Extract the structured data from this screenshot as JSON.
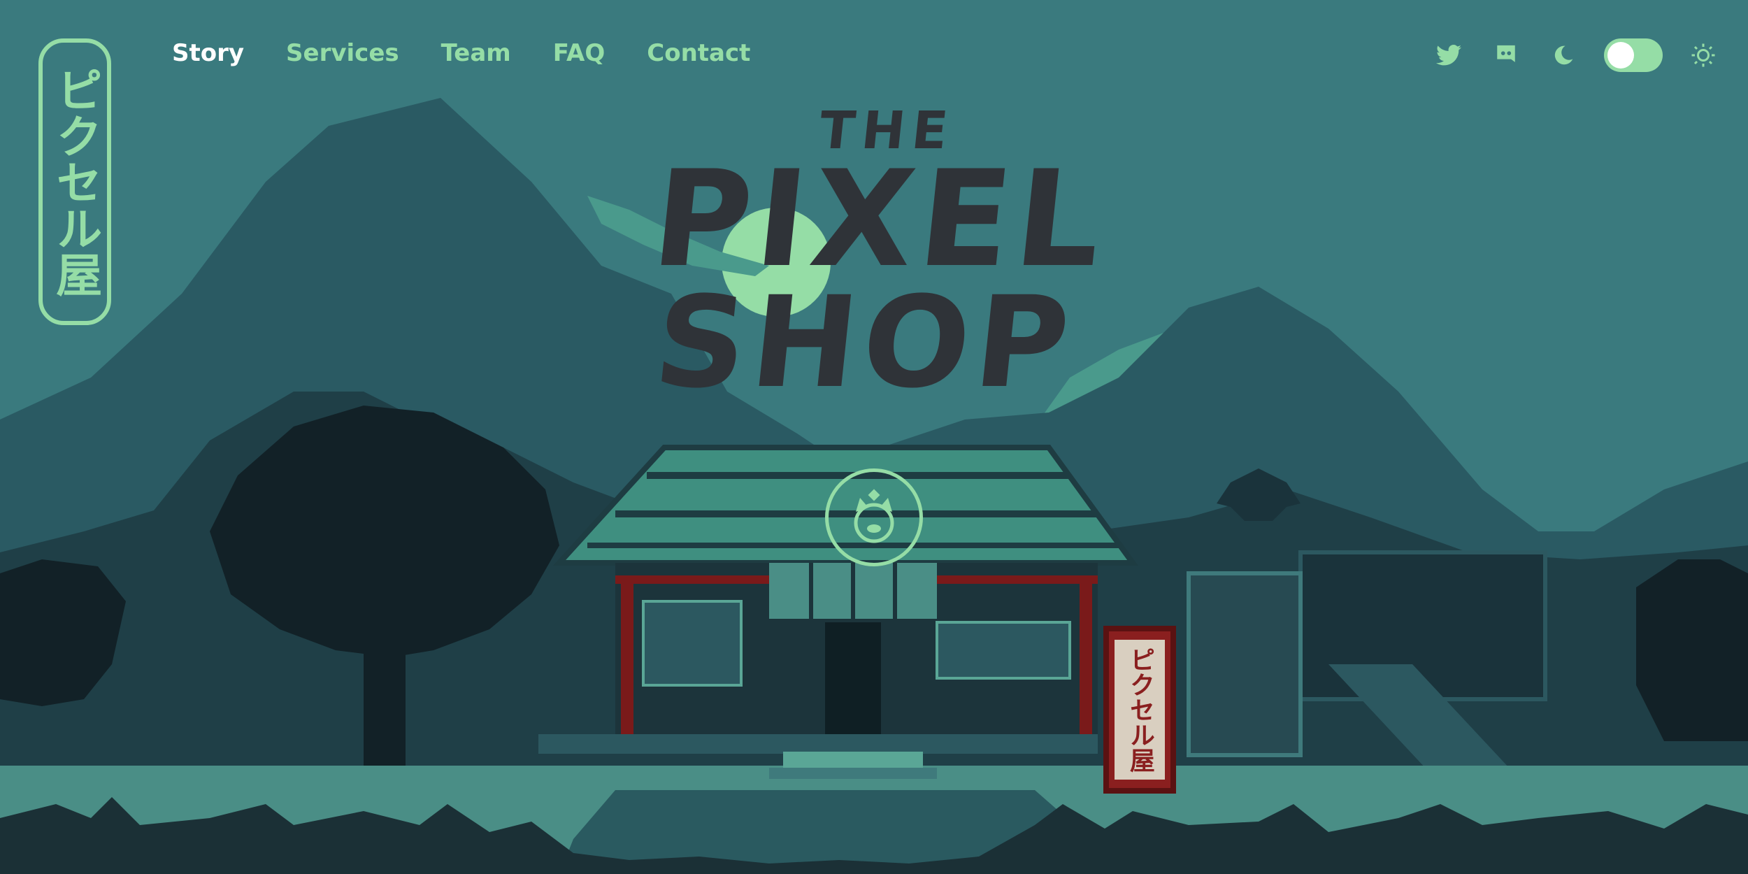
{
  "brand": {
    "badge_text": "ピクセル屋"
  },
  "nav": {
    "items": [
      {
        "label": "Story",
        "active": true
      },
      {
        "label": "Services",
        "active": false
      },
      {
        "label": "Team",
        "active": false
      },
      {
        "label": "FAQ",
        "active": false
      },
      {
        "label": "Contact",
        "active": false
      }
    ]
  },
  "header_icons": {
    "twitter": "twitter-icon",
    "discord": "discord-icon",
    "dark_mode": "moon-icon",
    "light_mode": "sun-icon"
  },
  "hero": {
    "title_line1": "THE",
    "title_line2": "PIXEL",
    "title_line3": "SHOP",
    "sign_text": "ピクセル屋"
  },
  "theme": {
    "sky": "#3a7a7e",
    "accent": "#95dda6",
    "title_color": "#2f3338",
    "sign_red": "#8a1f1f"
  }
}
